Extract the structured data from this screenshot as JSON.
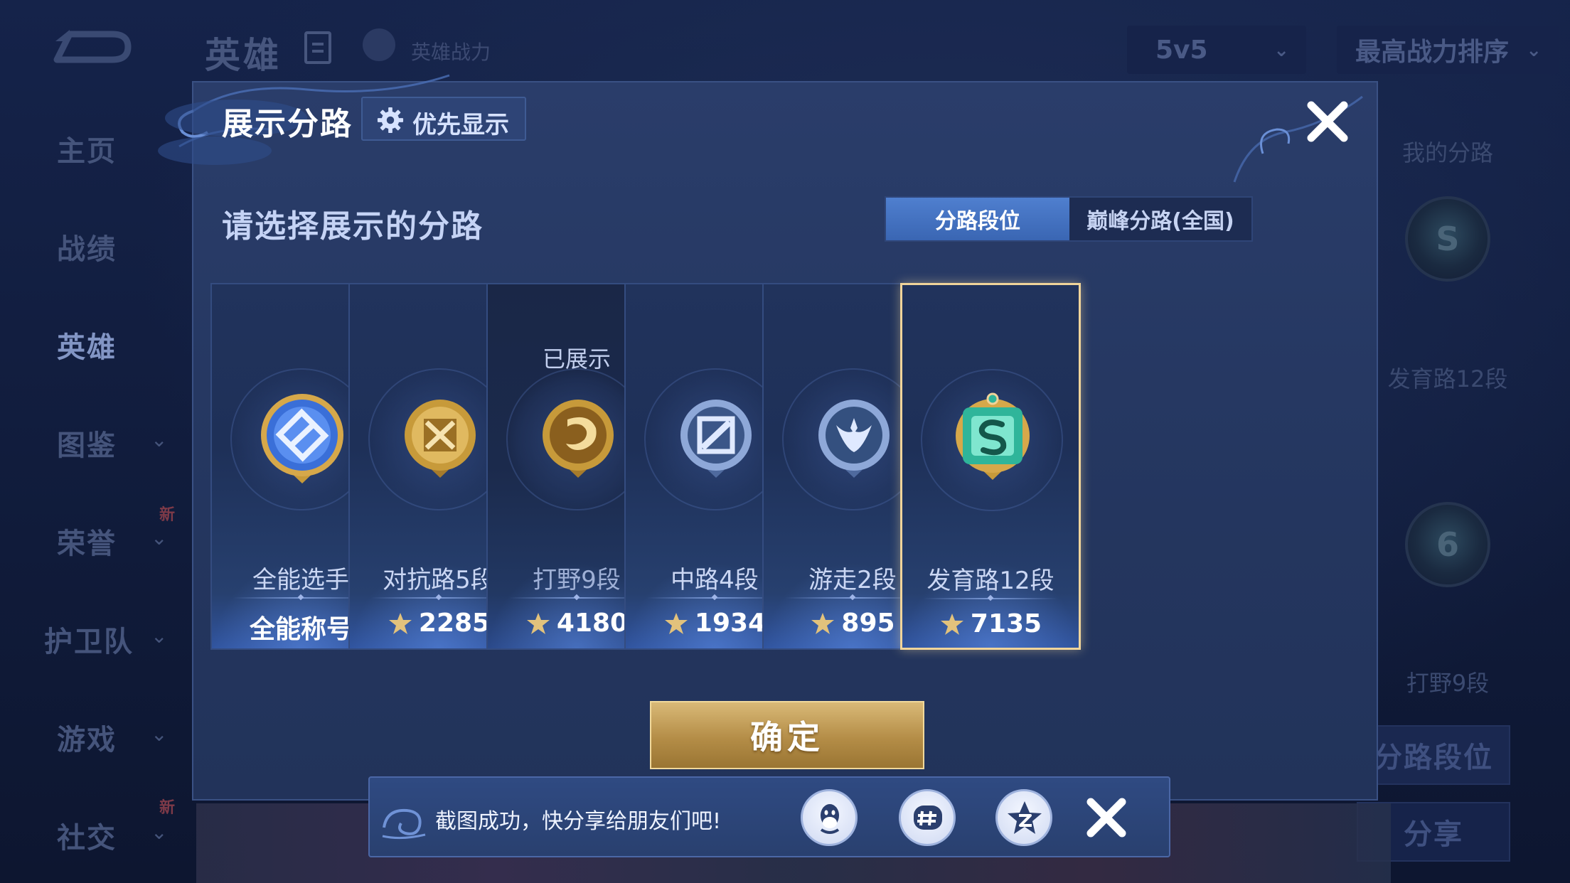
{
  "background": {
    "title": "英雄",
    "hero_power_label": "英雄战力",
    "mode_dropdown": "5v5",
    "sort_dropdown": "最高战力排序",
    "sidebar": [
      {
        "label": "主页",
        "chevron": false,
        "new": false,
        "active": false
      },
      {
        "label": "战绩",
        "chevron": false,
        "new": false,
        "active": false
      },
      {
        "label": "英雄",
        "chevron": false,
        "new": false,
        "active": true
      },
      {
        "label": "图鉴",
        "chevron": true,
        "new": false,
        "active": false
      },
      {
        "label": "荣誉",
        "chevron": true,
        "new": true,
        "active": false
      },
      {
        "label": "护卫队",
        "chevron": true,
        "new": false,
        "active": false
      },
      {
        "label": "游戏",
        "chevron": true,
        "new": false,
        "active": false
      },
      {
        "label": "社交",
        "chevron": true,
        "new": true,
        "active": false
      }
    ],
    "new_badge": "新",
    "right_panel": {
      "header": "我的分路",
      "lane1": "发育路12段",
      "lane2": "打野9段",
      "button1": "分路段位",
      "button2": "分享"
    }
  },
  "dialog": {
    "title": "展示分路",
    "priority_button": "优先显示",
    "subtitle": "请选择展示的分路",
    "tabs": [
      "分路段位",
      "巅峰分路(全国)"
    ],
    "active_tab": 0,
    "confirm": "确定",
    "cards": [
      {
        "name": "全能选手",
        "value": "全能称号",
        "power_icon": false,
        "shown_label": "",
        "selected": false,
        "medal": "all-round-medal-icon",
        "medal_color": "#3a6fd8"
      },
      {
        "name": "对抗路5段",
        "value": "2285",
        "power_icon": true,
        "shown_label": "",
        "selected": false,
        "medal": "clash-lane-medal-icon",
        "medal_color": "#c79a3a"
      },
      {
        "name": "打野9段",
        "value": "4180",
        "power_icon": true,
        "shown_label": "已展示",
        "selected": false,
        "medal": "jungle-medal-icon",
        "medal_color": "#c79a3a"
      },
      {
        "name": "中路4段",
        "value": "1934",
        "power_icon": true,
        "shown_label": "",
        "selected": false,
        "medal": "mid-lane-medal-icon",
        "medal_color": "#6f8fc8"
      },
      {
        "name": "游走2段",
        "value": "895",
        "power_icon": true,
        "shown_label": "",
        "selected": false,
        "medal": "roam-medal-icon",
        "medal_color": "#6f8fc8"
      },
      {
        "name": "发育路12段",
        "value": "7135",
        "power_icon": true,
        "shown_label": "",
        "selected": true,
        "medal": "farm-lane-medal-icon",
        "medal_color": "#2fb59a"
      }
    ]
  },
  "toast": {
    "message": "截图成功，快分享给朋友们吧!",
    "share_targets": [
      "qq-icon",
      "wechat-moments-icon",
      "qzone-icon"
    ]
  }
}
